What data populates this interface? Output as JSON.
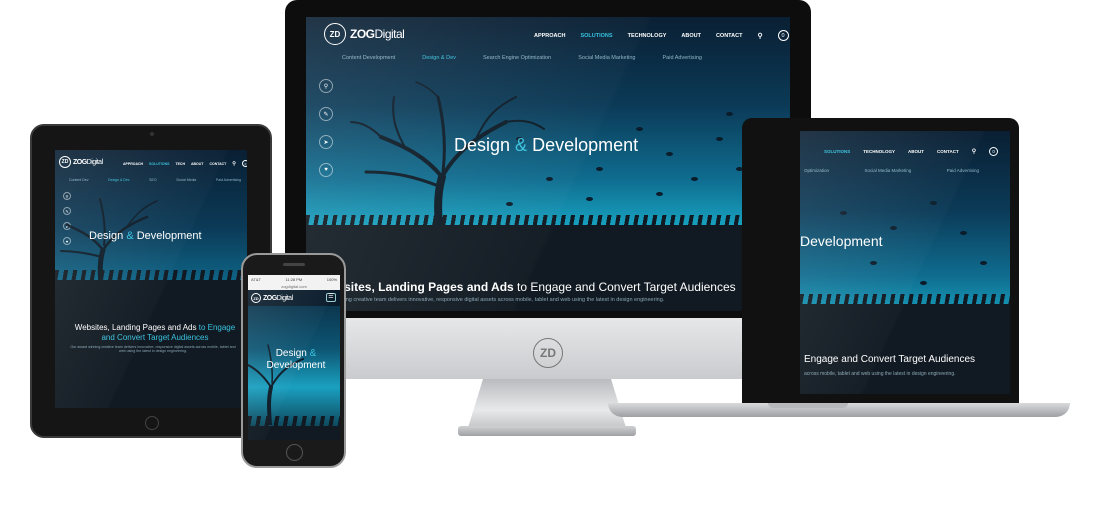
{
  "brand": {
    "mark": "ZD",
    "name_bold": "ZOG",
    "name_light": "Digital",
    "accent_color": "#39c3df"
  },
  "nav": {
    "items": [
      "APPROACH",
      "SOLUTIONS",
      "TECHNOLOGY",
      "ABOUT",
      "CONTACT"
    ],
    "active": "SOLUTIONS",
    "search_icon": "search-icon",
    "cart_badge": "0"
  },
  "ipad_nav": {
    "items": [
      "APPROACH",
      "SOLUTIONS",
      "TECH",
      "ABOUT",
      "CONTACT"
    ],
    "subnav": [
      "Content Dev",
      "Design & Dev",
      "SEO",
      "Social Media",
      "Paid Advertising"
    ]
  },
  "subnav": {
    "items": [
      "Content Development",
      "Design & Dev",
      "Search Engine Optimization",
      "Social Media Marketing",
      "Paid Advertising"
    ],
    "active": "Design & Dev"
  },
  "hero": {
    "title_a": "Design",
    "amp": "&",
    "title_b": "Development"
  },
  "intro": {
    "headline_bold": "Websites, Landing Pages and Ads",
    "headline_rest": " to Engage and Convert Target Audiences",
    "body": "Our award winning creative team delivers innovative, responsive digital assets across mobile, tablet and web using the latest in design engineering."
  },
  "macbook": {
    "nav": [
      "SOLUTIONS",
      "TECHNOLOGY",
      "ABOUT",
      "CONTACT"
    ],
    "subnav": [
      "Optimization",
      "Social Media Marketing",
      "Paid Advertising"
    ],
    "title": "Development",
    "headline": "Engage and Convert Target Audiences",
    "body": "across mobile, tablet and web using the latest in design engineering."
  },
  "iphone": {
    "carrier": "AT&T",
    "time": "11:28 PM",
    "battery": "100%",
    "url": "zogdigital.com",
    "title_a": "Design",
    "amp": "&",
    "title_b": "Development",
    "menu_icon": "hamburger-menu-icon"
  },
  "imac_chin_logo": "ZD"
}
